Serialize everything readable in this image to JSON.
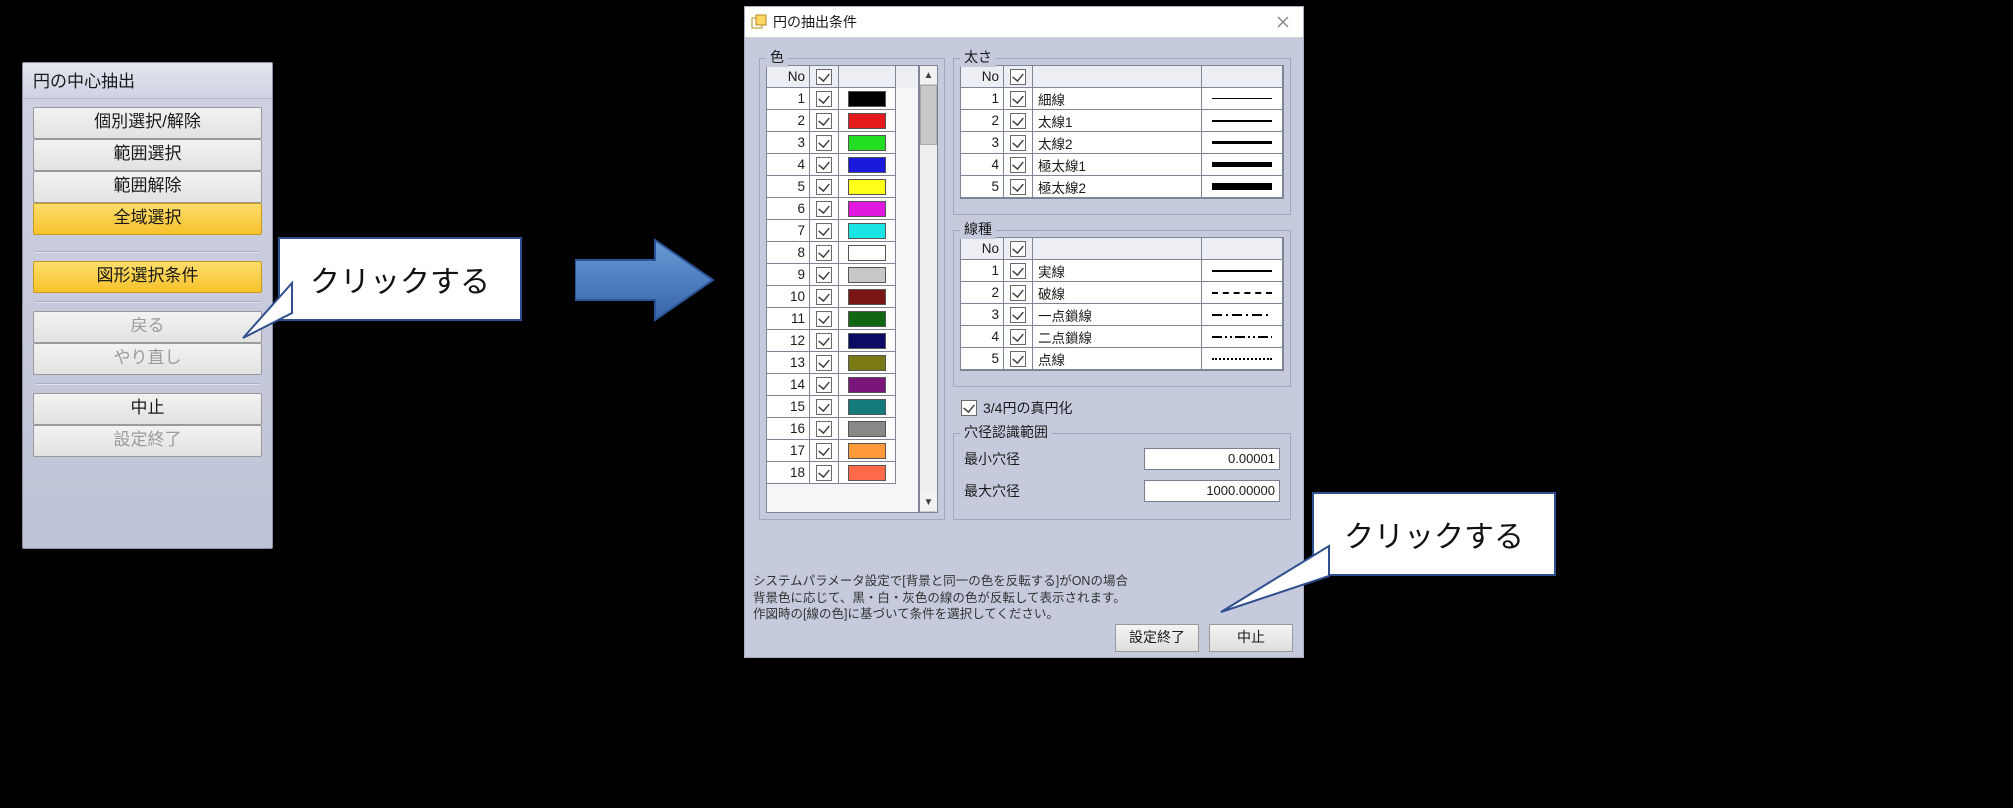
{
  "left_panel": {
    "title": "円の中心抽出",
    "btns": [
      {
        "label": "個別選択/解除",
        "style": "normal",
        "name": "btn-individual-select"
      },
      {
        "label": "範囲選択",
        "style": "normal",
        "name": "btn-range-select"
      },
      {
        "label": "範囲解除",
        "style": "normal",
        "name": "btn-range-clear"
      },
      {
        "label": "全域選択",
        "style": "hi",
        "name": "btn-select-all"
      }
    ],
    "cond_btn": {
      "label": "図形選択条件",
      "name": "btn-shape-select-condition"
    },
    "undo_btn": {
      "label": "戻る",
      "name": "btn-back"
    },
    "redo_btn": {
      "label": "やり直し",
      "name": "btn-redo"
    },
    "cancel_btn": {
      "label": "中止",
      "name": "btn-cancel-left"
    },
    "finish_btn": {
      "label": "設定終了",
      "name": "btn-finish-left"
    }
  },
  "callout1": "クリックする",
  "callout2": "クリックする",
  "dialog": {
    "title": "円の抽出条件",
    "color_group": "色",
    "thick_group": "太さ",
    "style_group": "線種",
    "head_no": "No",
    "colors": [
      {
        "no": 1,
        "hex": "#000000"
      },
      {
        "no": 2,
        "hex": "#e31b1b"
      },
      {
        "no": 3,
        "hex": "#22dd22"
      },
      {
        "no": 4,
        "hex": "#1a1add"
      },
      {
        "no": 5,
        "hex": "#ffff1a"
      },
      {
        "no": 6,
        "hex": "#e018e0"
      },
      {
        "no": 7,
        "hex": "#1be4e4"
      },
      {
        "no": 8,
        "hex": "#ffffff"
      },
      {
        "no": 9,
        "hex": "#c8c8c8"
      },
      {
        "no": 10,
        "hex": "#7a1515"
      },
      {
        "no": 11,
        "hex": "#116611"
      },
      {
        "no": 12,
        "hex": "#0b0b66"
      },
      {
        "no": 13,
        "hex": "#7a7a15"
      },
      {
        "no": 14,
        "hex": "#7a157a"
      },
      {
        "no": 15,
        "hex": "#157a7a"
      },
      {
        "no": 16,
        "hex": "#888888"
      },
      {
        "no": 17,
        "hex": "#ff9a3a"
      },
      {
        "no": 18,
        "hex": "#ff6a4a"
      }
    ],
    "thicks": [
      {
        "no": 1,
        "name": "細線",
        "sample": "line-thin"
      },
      {
        "no": 2,
        "name": "太線1",
        "sample": "line-med"
      },
      {
        "no": 3,
        "name": "太線2",
        "sample": "line-bold"
      },
      {
        "no": 4,
        "name": "極太線1",
        "sample": "line-xbold"
      },
      {
        "no": 5,
        "name": "極太線2",
        "sample": "line-xxbold"
      }
    ],
    "styles": [
      {
        "no": 1,
        "name": "実線",
        "sample": "ls-solid"
      },
      {
        "no": 2,
        "name": "破線",
        "sample": "ls-dash"
      },
      {
        "no": 3,
        "name": "一点鎖線",
        "sample": "ls-dashdot"
      },
      {
        "no": 4,
        "name": "二点鎖線",
        "sample": "ls-dashdotdot"
      },
      {
        "no": 5,
        "name": "点線",
        "sample": "ls-dot"
      }
    ],
    "round34": "3/4円の真円化",
    "hole_group": "穴径認識範囲",
    "min_label": "最小穴径",
    "min_value": "0.00001",
    "max_label": "最大穴径",
    "max_value": "1000.00000",
    "note1": "システムパラメータ設定で[背景と同一の色を反転する]がONの場合",
    "note2": "背景色に応じて、黒・白・灰色の線の色が反転して表示されます。",
    "note3": "作図時の[線の色]に基づいて条件を選択してください。",
    "ok_btn": "設定終了",
    "cancel_btn": "中止"
  }
}
